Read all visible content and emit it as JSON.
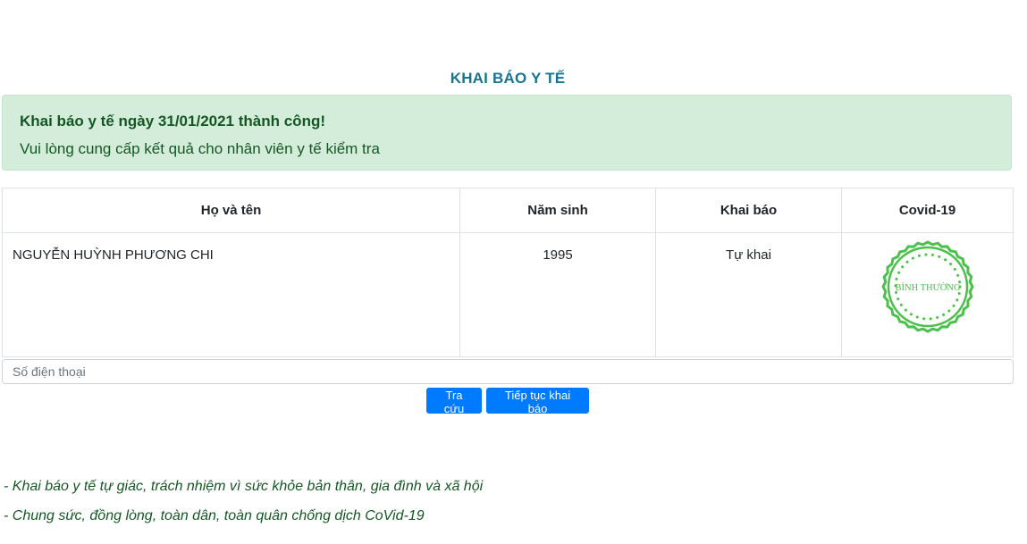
{
  "page": {
    "title": "KHAI BÁO Y TẾ"
  },
  "alert": {
    "title": "Khai báo y tế ngày 31/01/2021 thành công!",
    "message": "Vui lòng cung cấp kết quả cho nhân viên y tế kiểm tra",
    "color": "#155724",
    "background": "#d4edda"
  },
  "table": {
    "headers": [
      "Họ và tên",
      "Năm sinh",
      "Khai báo",
      "Covid-19"
    ],
    "rows": [
      {
        "name": "NGUYỄN HUỲNH PHƯƠNG CHI",
        "birth_year": "1995",
        "declaration": "Tự khai",
        "covid_stamp": {
          "text": "BÌNH THƯỜNG",
          "icon": "status-stamp-icon",
          "color": "#4cc04c"
        }
      }
    ]
  },
  "phone": {
    "placeholder": "Số điện thoại",
    "value": ""
  },
  "buttons": {
    "lookup": "Tra cứu",
    "continue": "Tiếp tục khai báo",
    "color": "#007bff"
  },
  "notes": [
    "- Khai báo y tế tự giác, trách nhiệm vì sức khỏe bản thân, gia đình và xã hội",
    "- Chung sức, đồng lòng, toàn dân, toàn quân chống dịch CoVid-19"
  ],
  "accent_color": "#17758f"
}
